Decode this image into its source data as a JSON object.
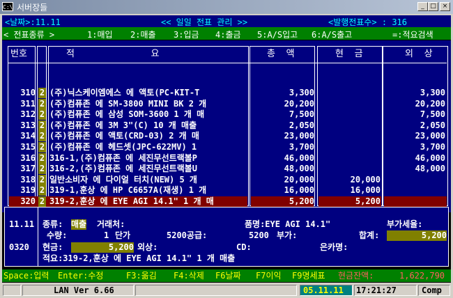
{
  "window": {
    "title": "서버장들",
    "icon": "C:\\",
    "min": "_",
    "max": "□",
    "close": "×"
  },
  "header": {
    "date_label": "<날짜>:11.11",
    "title": "<< 일일 전표 관리 >>",
    "issued_label": "<발행전표수> : 316"
  },
  "menu": {
    "item0": "< 전표종류 >",
    "item1": "1:매입",
    "item2": "2:매출",
    "item3": "3:입금",
    "item4": "4:출금",
    "item5": "5:A/S입고",
    "item6": "6:A/S출고",
    "item7": "=:적요검색"
  },
  "columns": {
    "num": "번호",
    "desc": "적              요",
    "amount": "총  액",
    "cash": "현  금",
    "credit": "외  상"
  },
  "rows": [
    {
      "num": "310",
      "flag": "2",
      "desc": "(주)닉스케이엠에스 에 액토(PC-KIT-T",
      "amount": "3,300",
      "cash": "",
      "credit": "3,300"
    },
    {
      "num": "311",
      "flag": "2",
      "desc": "(주)컴퓨존 에 SM-3800 MINI BK 2 개",
      "amount": "20,200",
      "cash": "",
      "credit": "20,200"
    },
    {
      "num": "312",
      "flag": "2",
      "desc": "(주)컴퓨존 에 삼성 SOM-3600 1 개 매",
      "amount": "7,500",
      "cash": "",
      "credit": "7,500"
    },
    {
      "num": "313",
      "flag": "2",
      "desc": "(주)컴퓨존 에 3M 3\"(C) 10 개 매출",
      "amount": "2,050",
      "cash": "",
      "credit": "2,050"
    },
    {
      "num": "314",
      "flag": "2",
      "desc": "(주)컴퓨존 에 액토(CRD-03) 2 개 매",
      "amount": "23,000",
      "cash": "",
      "credit": "23,000"
    },
    {
      "num": "315",
      "flag": "2",
      "desc": "(주)컴퓨존 에 헤드셋(JPC-622MV) 1",
      "amount": "3,700",
      "cash": "",
      "credit": "3,700"
    },
    {
      "num": "316",
      "flag": "2",
      "desc": "316-1,(주)컴퓨존 에 세진무선트랙볼P",
      "amount": "46,000",
      "cash": "",
      "credit": "46,000"
    },
    {
      "num": "317",
      "flag": "2",
      "desc": "316-2,(주)컴퓨존 에 세진무선트랙볼U",
      "amount": "48,000",
      "cash": "",
      "credit": "48,000"
    },
    {
      "num": "318",
      "flag": "2",
      "desc": "일반소비자 에 다이얼 터치(NEW) 5 개",
      "amount": "20,000",
      "cash": "20,000",
      "credit": ""
    },
    {
      "num": "319",
      "flag": "2",
      "desc": "319-1,훈상 에 HP C6657A(재생) 1 개",
      "amount": "16,000",
      "cash": "16,000",
      "credit": ""
    },
    {
      "num": "320",
      "flag": "2",
      "desc": "319-2,훈상 에 EYE AGI 14.1\" 1 개 매",
      "amount": "5,200",
      "cash": "5,200",
      "credit": ""
    }
  ],
  "detail": {
    "date": "11.11",
    "slip_no": "0320",
    "type_label": "종류:",
    "type_value": "매출",
    "vendor_label": "거래처:",
    "product_label": "품명:EYE AGI 14.1\"",
    "vat_label": "부가세율:",
    "qty_label": "수량:",
    "qty_value": "1",
    "unit_label": "단가",
    "supply_text": "5200공급:",
    "supply_value": "5200",
    "vat_text": "부가:",
    "total_label": "합계:",
    "total_value": "5,200",
    "cash_label": "현금:",
    "cash_value": "5,200",
    "credit_label": "외상:",
    "cd_label": "CD:",
    "bank_label": "은카명:",
    "memo": "적요:319-2,훈상 에 EYE AGI 14.1\" 1 개 매출"
  },
  "fkeys": {
    "k1": "Space:입력",
    "k2": "Enter:수정",
    "k3": "F3:옮김",
    "k4": "F4:삭제",
    "k5": "F6날짜",
    "k6": "F7이익",
    "k7": "F9명세표",
    "balance_label": "현금잔액:",
    "balance_value": "1,622,790"
  },
  "status": {
    "lan": "LAN Ver 6.66",
    "date": "05.11.11",
    "time": "17:21:27",
    "mode": "Comp"
  },
  "colors": {
    "background": "#000080",
    "menu_bar": "#008000",
    "selected_row": "#800000",
    "highlight_field": "#808000"
  }
}
